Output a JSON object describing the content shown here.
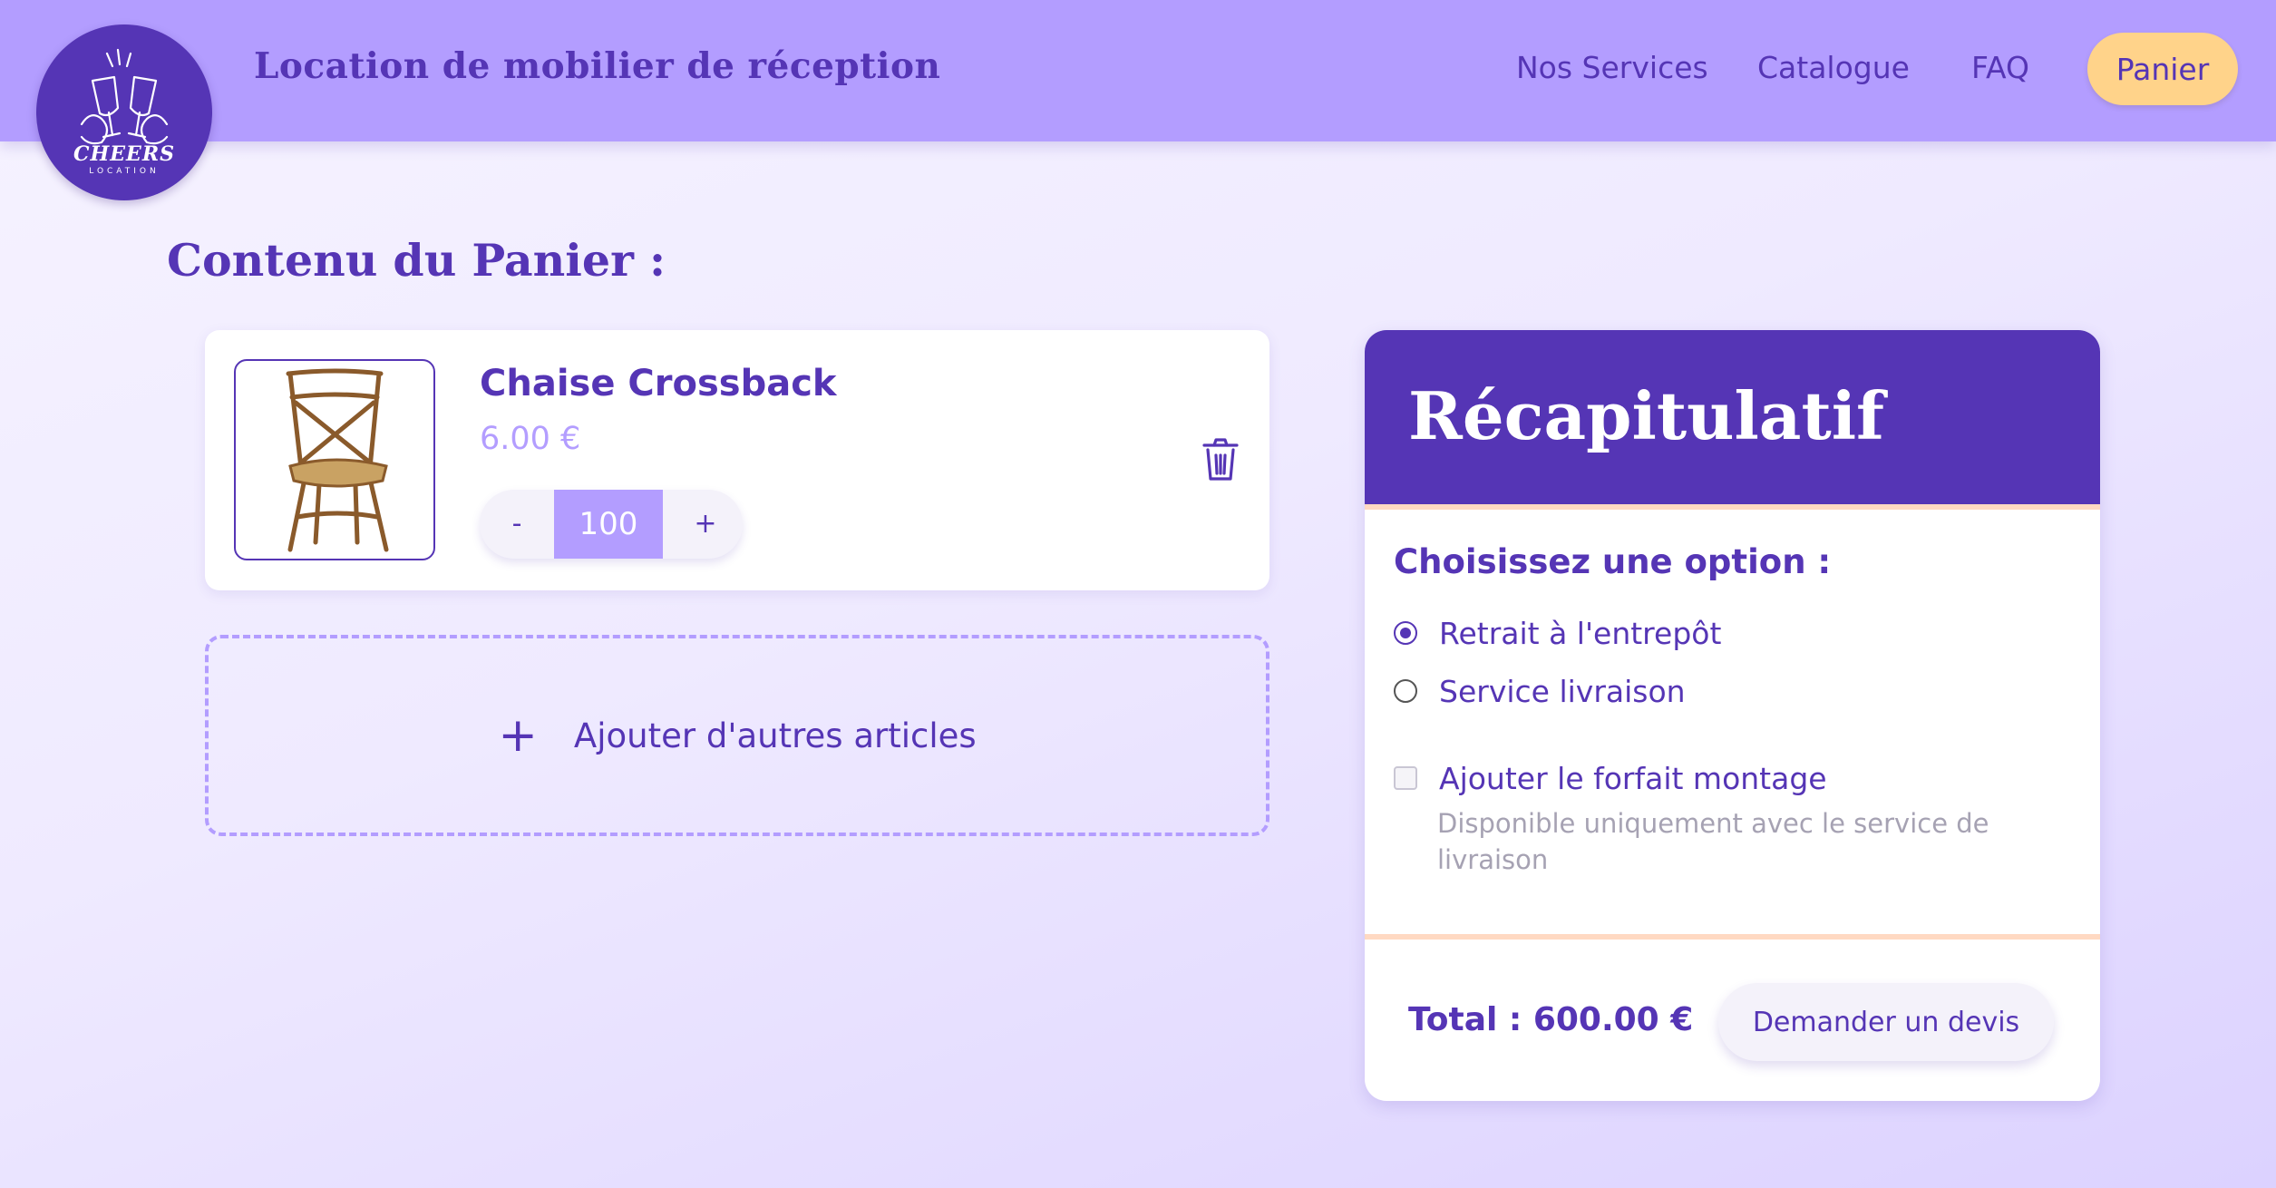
{
  "header": {
    "logo": {
      "word": "CHEERS",
      "sub": "LOCATION"
    },
    "site_title": "Location de mobilier de réception",
    "nav": {
      "services": "Nos Services",
      "catalogue": "Catalogue",
      "faq": "FAQ",
      "cart": "Panier"
    }
  },
  "cart": {
    "title": "Contenu du Panier :",
    "items": [
      {
        "name": "Chaise Crossback",
        "price": "6.00 €",
        "quantity": "100",
        "minus_label": "-",
        "plus_label": "+"
      }
    ],
    "add_more": {
      "icon": "+",
      "label": "Ajouter d'autres articles"
    }
  },
  "summary": {
    "title": "Récapitulatif",
    "option_title": "Choisissez une option :",
    "options": [
      {
        "label": "Retrait à l'entrepôt",
        "checked": true
      },
      {
        "label": "Service livraison",
        "checked": false
      }
    ],
    "assembly": {
      "label": "Ajouter le forfait montage",
      "checked": false,
      "note": "Disponible uniquement avec le service de livraison"
    },
    "total": "Total : 600.00 €",
    "quote_button": "Demander un devis"
  },
  "colors": {
    "primary": "#5535b5",
    "header_bg": "#b39dff",
    "accent": "#ffd38a"
  },
  "icons": {
    "logo": "toasting-glasses-icon",
    "delete": "trash-icon",
    "add": "plus-icon"
  }
}
